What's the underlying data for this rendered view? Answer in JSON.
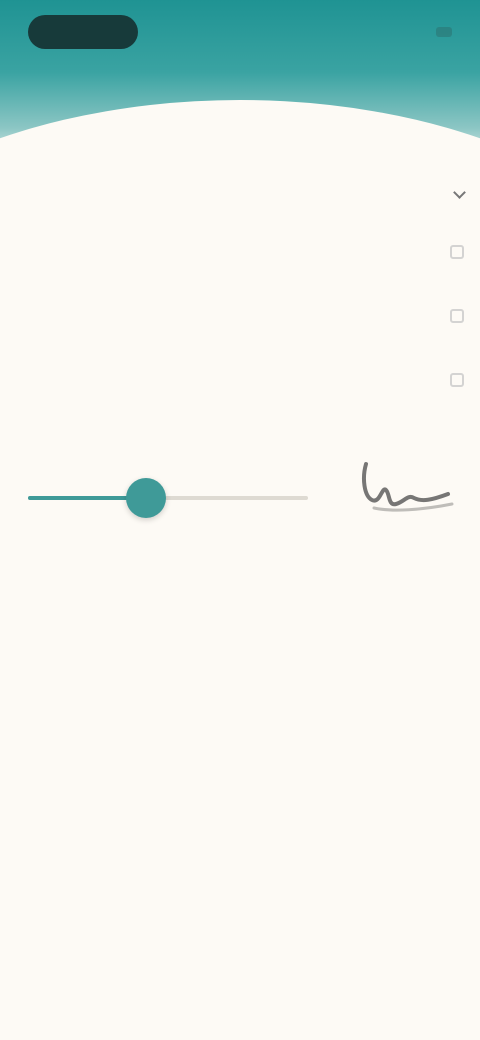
{
  "status_bar": {
    "time": "",
    "indicators": ""
  },
  "picker": {
    "label": "",
    "value": ""
  },
  "settings": [
    {
      "label": ""
    },
    {
      "label": ""
    },
    {
      "label": ""
    }
  ],
  "slider": {
    "caption": "",
    "value_fraction": 0.42
  },
  "icons": {
    "picker_chevron": "chevron-down-icon",
    "signature": "signature-icon"
  },
  "colors": {
    "accent": "#3f9a98",
    "header_top": "#1f9393",
    "background": "#fdfaf5"
  }
}
